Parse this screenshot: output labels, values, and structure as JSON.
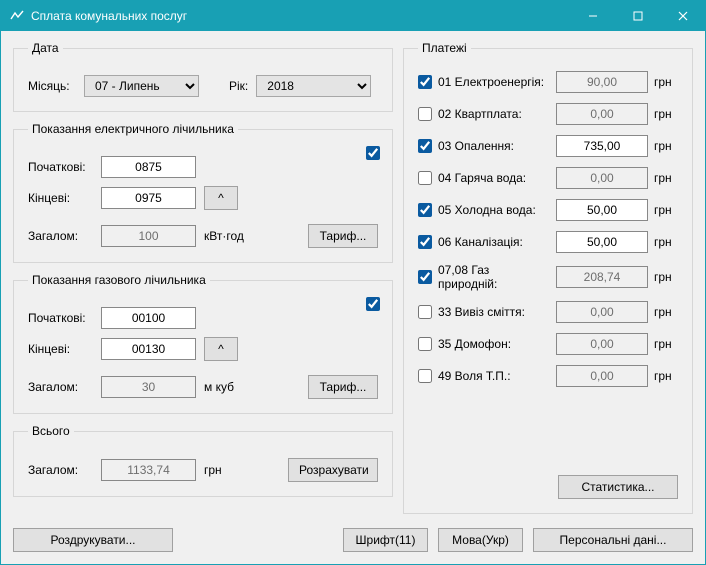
{
  "window": {
    "title": "Сплата комунальних послуг"
  },
  "date": {
    "legend": "Дата",
    "month_label": "Місяць:",
    "month_value": "07 - Липень",
    "year_label": "Рік:",
    "year_value": "2018"
  },
  "electric": {
    "legend": "Показання електричного лічильника",
    "enabled": true,
    "start_label": "Початкові:",
    "start_value": "0875",
    "end_label": "Кінцеві:",
    "end_value": "0975",
    "total_label": "Загалом:",
    "total_value": "100",
    "unit": "кВт·год",
    "tariff_btn": "Тариф...",
    "up_btn": "^"
  },
  "gas": {
    "legend": "Показання газового лічильника",
    "enabled": true,
    "start_label": "Початкові:",
    "start_value": "00100",
    "end_label": "Кінцеві:",
    "end_value": "00130",
    "total_label": "Загалом:",
    "total_value": "30",
    "unit": "м куб",
    "tariff_btn": "Тариф...",
    "up_btn": "^"
  },
  "total": {
    "legend": "Всього",
    "total_label": "Загалом:",
    "total_value": "1133,74",
    "unit": "грн",
    "calc_btn": "Розрахувати"
  },
  "payments": {
    "legend": "Платежі",
    "unit": "грн",
    "items": [
      {
        "label": "01 Електроенергія:",
        "checked": true,
        "value": "90,00",
        "readonly": true
      },
      {
        "label": "02 Квартплата:",
        "checked": false,
        "value": "0,00",
        "readonly": true
      },
      {
        "label": "03 Опалення:",
        "checked": true,
        "value": "735,00",
        "readonly": false
      },
      {
        "label": "04 Гаряча вода:",
        "checked": false,
        "value": "0,00",
        "readonly": true
      },
      {
        "label": "05 Холодна вода:",
        "checked": true,
        "value": "50,00",
        "readonly": false
      },
      {
        "label": "06 Каналізація:",
        "checked": true,
        "value": "50,00",
        "readonly": false
      },
      {
        "label": "07,08 Газ природній:",
        "checked": true,
        "value": "208,74",
        "readonly": true
      },
      {
        "label": "33 Вивіз сміття:",
        "checked": false,
        "value": "0,00",
        "readonly": true
      },
      {
        "label": "35 Домофон:",
        "checked": false,
        "value": "0,00",
        "readonly": true
      },
      {
        "label": "49 Воля Т.П.:",
        "checked": false,
        "value": "0,00",
        "readonly": true
      }
    ],
    "stats_btn": "Статистика..."
  },
  "footer": {
    "print_btn": "Роздрукувати...",
    "font_btn": "Шрифт(11)",
    "lang_btn": "Мова(Укр)",
    "personal_btn": "Персональні дані..."
  }
}
